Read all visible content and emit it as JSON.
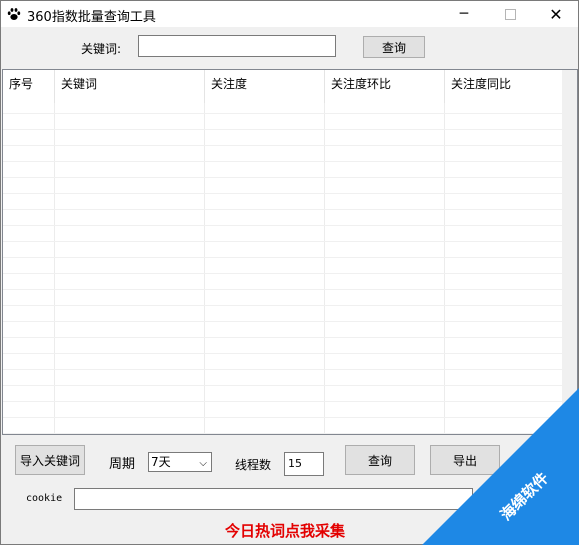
{
  "window": {
    "title": "360指数批量查询工具",
    "controls": {
      "minimize": "─",
      "close": "✕"
    }
  },
  "search": {
    "keyword_label": "关键词:",
    "query_button": "查询"
  },
  "table": {
    "columns": [
      "序号",
      "关键词",
      "关注度",
      "关注度环比",
      "关注度同比"
    ],
    "rows": []
  },
  "controls": {
    "import_button": "导入关键词",
    "period_label": "周期",
    "period_value": "7天",
    "threads_label": "线程数",
    "threads_value": "15",
    "query_button": "查询",
    "export_button": "导出"
  },
  "cookie": {
    "label": "cookie"
  },
  "footer": {
    "hot_link": "今日热词点我采集"
  },
  "watermark": {
    "text": "海绵软件",
    "color": "#1e88e5"
  },
  "colors": {
    "link_red": "#e30000",
    "window_bg": "#f0f0f0"
  }
}
